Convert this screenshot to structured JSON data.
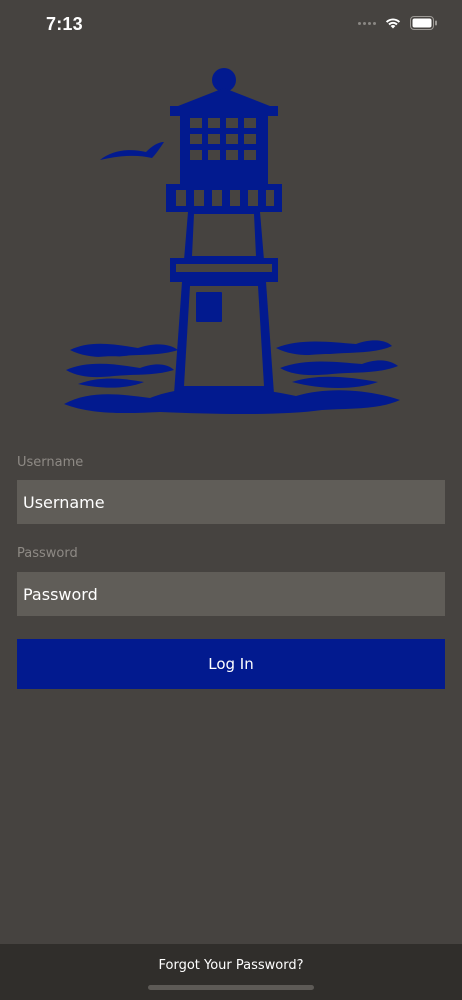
{
  "status_bar": {
    "time": "7:13"
  },
  "form": {
    "username_label": "Username",
    "username_placeholder": "Username",
    "username_value": "",
    "password_label": "Password",
    "password_placeholder": "Password",
    "password_value": "",
    "login_label": "Log In"
  },
  "footer": {
    "forgot_label": "Forgot Your Password?"
  },
  "icons": {
    "logo": "lighthouse-logo-icon",
    "wifi": "wifi-icon",
    "battery": "battery-icon",
    "signal": "cellular-signal-icon"
  },
  "colors": {
    "background": "#464340",
    "input_background": "#605d58",
    "accent": "#021a8f",
    "footer_background": "#302e2b"
  }
}
